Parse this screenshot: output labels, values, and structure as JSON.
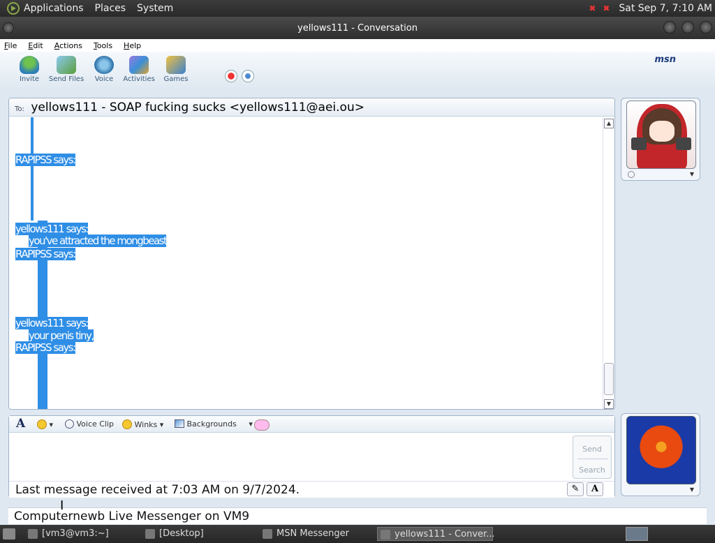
{
  "top_panel": {
    "applications": "Applications",
    "places": "Places",
    "system": "System",
    "clock": "Sat Sep  7, 7:10 AM"
  },
  "window": {
    "title": "yellows111 - Conversation"
  },
  "menubar": {
    "file": "File",
    "edit": "Edit",
    "actions": "Actions",
    "tools": "Tools",
    "help": "Help"
  },
  "toolbar": {
    "invite": "Invite",
    "send_files": "Send Files",
    "voice": "Voice",
    "activities": "Activities",
    "games": "Games",
    "logo": "msn"
  },
  "conversation": {
    "to_label": "To:",
    "to_value": "yellows111 - SOAP fucking sucks <yellows111@aei.ou>",
    "messages": [
      "RAPIPSS says:",
      "yellows111 says:",
      "you've attracted the mongbeast",
      "RAPIPSS says:",
      "yellows111 says:",
      "your penis tiny,",
      "RAPIPSS says:"
    ]
  },
  "format_bar": {
    "font": "A",
    "voice_clip": "Voice Clip",
    "winks": "Winks",
    "backgrounds": "Backgrounds"
  },
  "compose": {
    "send": "Send",
    "search": "Search",
    "status": "Last message received at 7:03 AM on 9/7/2024.",
    "text_btn": "A"
  },
  "window_status": "Computernewb Live Messenger on VM9",
  "taskbar": {
    "items": [
      "[vm3@vm3:~]",
      "[Desktop]",
      "MSN Messenger",
      "yellows111 - Conver..."
    ]
  }
}
